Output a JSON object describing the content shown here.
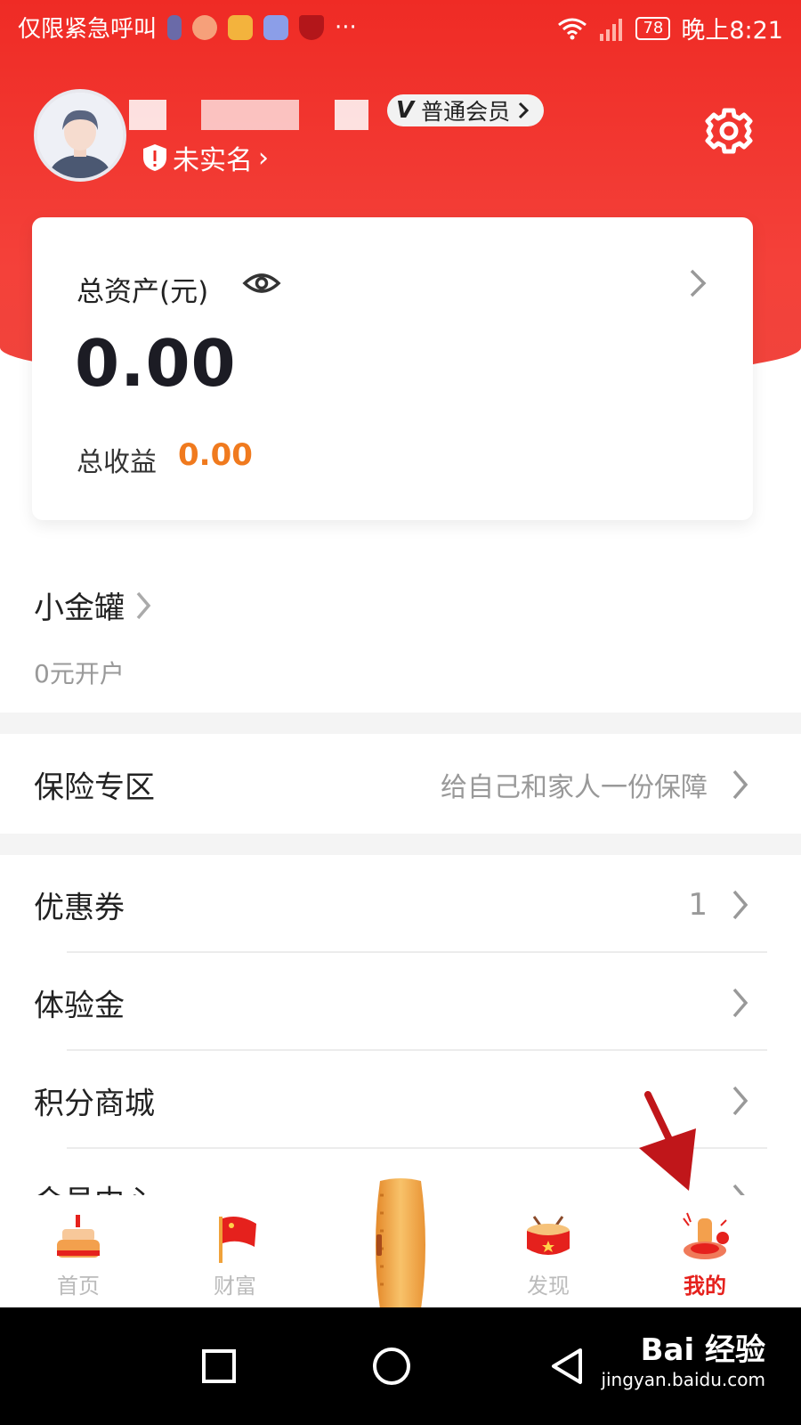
{
  "status_bar": {
    "left_text": "仅限紧急呼叫",
    "battery": "78",
    "time": "晚上8:21",
    "more": "···"
  },
  "profile": {
    "vip_badge": "普通会员",
    "vip_mark": "V",
    "real_name": "未实名",
    "real_name_chevron": "›"
  },
  "asset_card": {
    "label": "总资产(元)",
    "total": "0.00",
    "income_label": "总收益",
    "income_value": "0.00"
  },
  "jar": {
    "title": "小金罐",
    "subtitle": "0元开户"
  },
  "rows": [
    {
      "title": "保险专区",
      "right": "给自己和家人一份保障"
    },
    {
      "title": "优惠券",
      "right": "1"
    },
    {
      "title": "体验金",
      "right": ""
    },
    {
      "title": "积分商城",
      "right": ""
    },
    {
      "title": "会员中心",
      "right": ""
    }
  ],
  "tabs": [
    {
      "label": "首页",
      "icon": "cake-icon"
    },
    {
      "label": "财富",
      "icon": "flag-icon"
    },
    {
      "label": "发现",
      "icon": "drum-icon"
    },
    {
      "label": "我的",
      "icon": "lantern-icon"
    }
  ],
  "watermark": {
    "logo": "Bai 经验",
    "url": "jingyan.baidu.com"
  },
  "colors": {
    "brand_red": "#ef2b25",
    "income_orange": "#f07a1e",
    "active_tab": "#e5211d"
  }
}
